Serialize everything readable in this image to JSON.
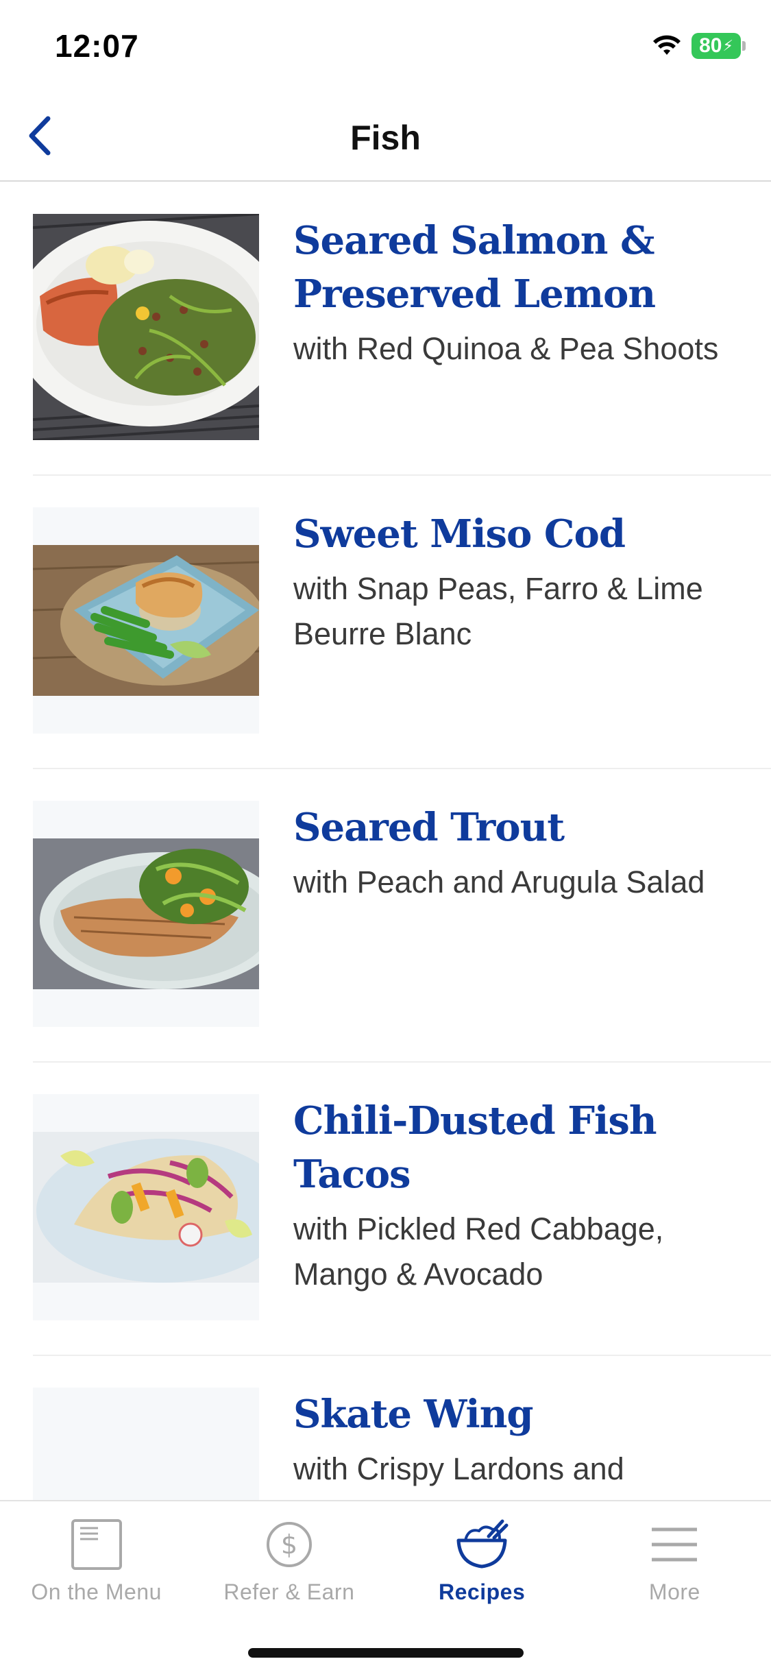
{
  "status": {
    "time": "12:07",
    "battery": "80"
  },
  "nav": {
    "title": "Fish"
  },
  "recipes": [
    {
      "title": "Seared Salmon & Preserved Lemon",
      "subtitle": "with Red Quinoa & Pea Shoots",
      "image": "salmon-photo"
    },
    {
      "title": "Sweet Miso Cod",
      "subtitle": "with Snap Peas, Farro & Lime Beurre Blanc",
      "image": "cod-photo"
    },
    {
      "title": "Seared Trout",
      "subtitle": "with Peach and Arugula Salad",
      "image": "trout-photo"
    },
    {
      "title": "Chili-Dusted Fish Tacos",
      "subtitle": "with Pickled Red Cabbage, Mango & Avocado",
      "image": "tacos-photo"
    },
    {
      "title": "Skate Wing",
      "subtitle": "with Crispy Lardons and",
      "image": "skate-photo-placeholder"
    }
  ],
  "tabs": [
    {
      "label": "On the Menu",
      "icon": "menu-card-icon",
      "active": false
    },
    {
      "label": "Refer & Earn",
      "icon": "dollar-icon",
      "active": false
    },
    {
      "label": "Recipes",
      "icon": "bowl-icon",
      "active": true
    },
    {
      "label": "More",
      "icon": "hamburger-icon",
      "active": false
    }
  ],
  "colors": {
    "accent": "#0f3b9c",
    "inactive_tab": "#a9a9a9",
    "battery": "#34c759"
  }
}
